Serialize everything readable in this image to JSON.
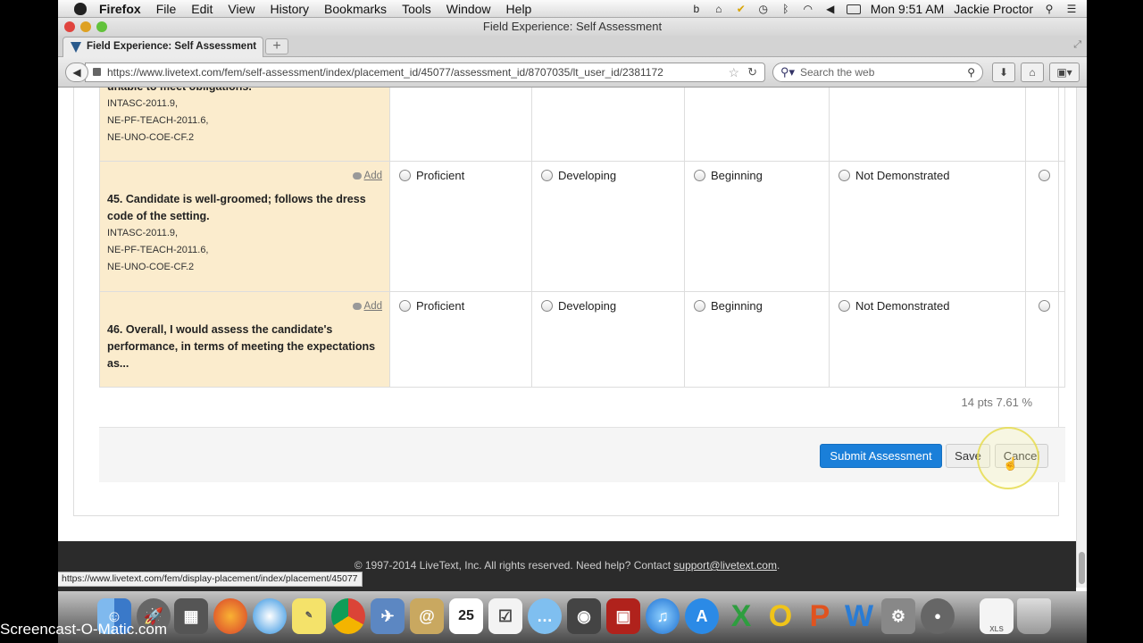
{
  "menubar": {
    "app": "Firefox",
    "items": [
      "File",
      "Edit",
      "View",
      "History",
      "Bookmarks",
      "Tools",
      "Window",
      "Help"
    ],
    "clock": "Mon 9:51 AM",
    "user": "Jackie Proctor"
  },
  "window": {
    "title": "Field Experience: Self Assessment"
  },
  "tab": {
    "label": "Field Experience: Self Assessment"
  },
  "nav": {
    "url": "https://www.livetext.com/fem/self-assessment/index/placement_id/45077/assessment_id/8707035/lt_user_id/2381172",
    "search_placeholder": "Search the web"
  },
  "rubric": {
    "options": [
      "Proficient",
      "Developing",
      "Beginning",
      "Not Demonstrated"
    ],
    "add_label": "Add",
    "rows": [
      {
        "question": "unable to meet obligations.",
        "standards": [
          "INTASC-2011.9,",
          "NE-PF-TEACH-2011.6,",
          "NE-UNO-COE-CF.2"
        ]
      },
      {
        "question": "45. Candidate is well-groomed; follows the dress code of the setting.",
        "standards": [
          "INTASC-2011.9,",
          "NE-PF-TEACH-2011.6,",
          "NE-UNO-COE-CF.2"
        ]
      },
      {
        "question": "46. Overall, I would assess the candidate's performance, in terms of meeting the expectations as...",
        "standards": []
      }
    ]
  },
  "score": "14 pts 7.61 %",
  "actions": {
    "submit": "Submit Assessment",
    "save": "Save",
    "cancel": "Cancel"
  },
  "footer": {
    "text": "© 1997-2014 LiveText, Inc. All rights reserved. Need help? Contact",
    "email": "support@livetext.com",
    "period": "."
  },
  "status_url": "https://www.livetext.com/fem/display-placement/index/placement/45077",
  "watermark": "Screencast-O-Matic.com",
  "dock": {
    "date": "25",
    "file_label": "XLS",
    "icons": [
      "finder-icon",
      "launchpad-icon",
      "utility-icon",
      "firefox-icon",
      "safari-icon",
      "stickies-icon",
      "chrome-icon",
      "preview-icon",
      "contacts-icon",
      "calendar-icon",
      "reminders-icon",
      "messages-icon",
      "facetime-icon",
      "photobooth-icon",
      "itunes-icon",
      "appstore-icon",
      "excel-icon",
      "outlook-icon",
      "powerpoint-icon",
      "word-icon",
      "sysprefs-icon",
      "som-icon",
      "xls-file-icon",
      "trash-icon"
    ]
  }
}
